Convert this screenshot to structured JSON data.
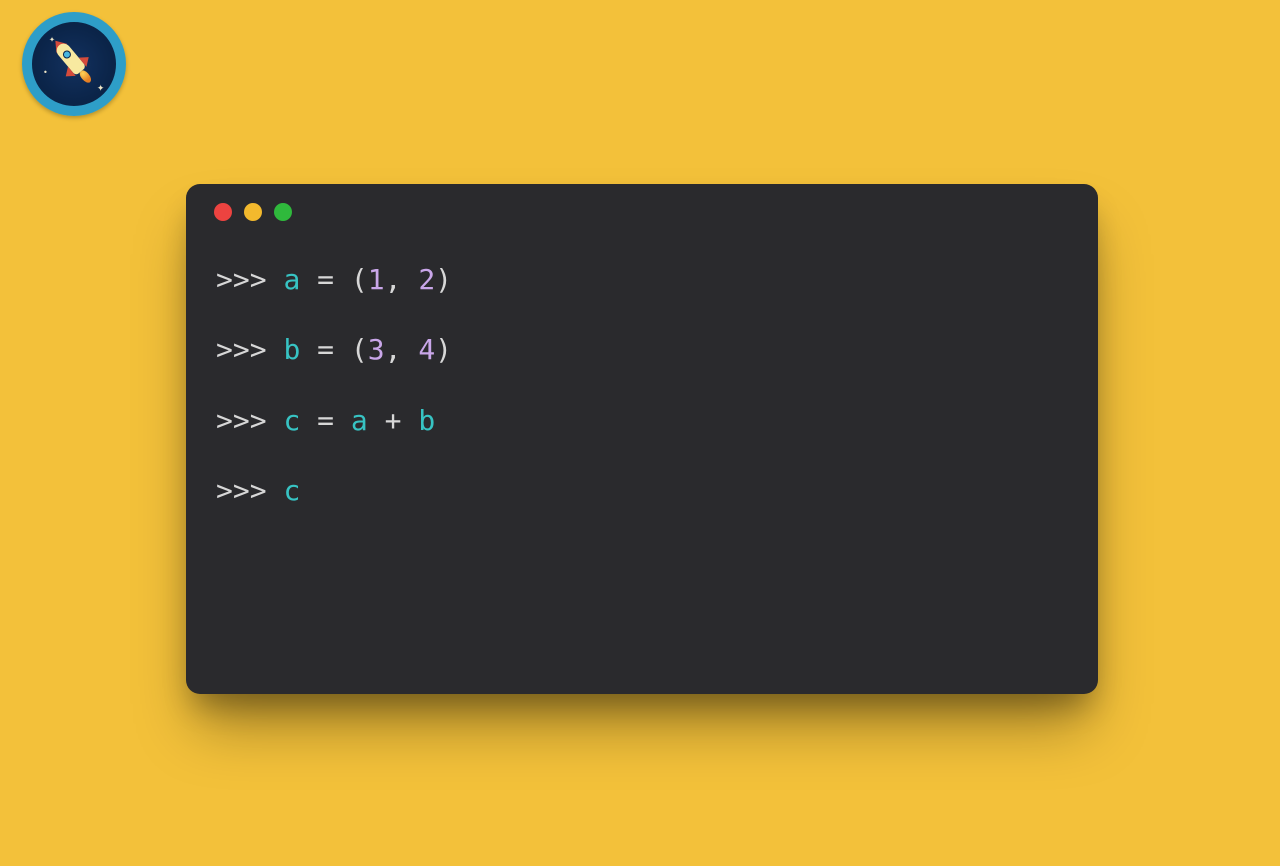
{
  "logo": {
    "name": "python-rocket-logo"
  },
  "window": {
    "traffic_lights": [
      "close",
      "minimize",
      "zoom"
    ]
  },
  "code": {
    "prompt": ">>>",
    "lines": [
      [
        {
          "type": "prompt",
          "text": ">>> "
        },
        {
          "type": "ident",
          "text": "a"
        },
        {
          "type": "op",
          "text": " = "
        },
        {
          "type": "punct",
          "text": "("
        },
        {
          "type": "number",
          "text": "1"
        },
        {
          "type": "punct",
          "text": ", "
        },
        {
          "type": "number",
          "text": "2"
        },
        {
          "type": "punct",
          "text": ")"
        }
      ],
      [
        {
          "type": "prompt",
          "text": ">>> "
        },
        {
          "type": "ident",
          "text": "b"
        },
        {
          "type": "op",
          "text": " = "
        },
        {
          "type": "punct",
          "text": "("
        },
        {
          "type": "number",
          "text": "3"
        },
        {
          "type": "punct",
          "text": ", "
        },
        {
          "type": "number",
          "text": "4"
        },
        {
          "type": "punct",
          "text": ")"
        }
      ],
      [
        {
          "type": "prompt",
          "text": ">>> "
        },
        {
          "type": "ident",
          "text": "c"
        },
        {
          "type": "op",
          "text": " = "
        },
        {
          "type": "ident",
          "text": "a"
        },
        {
          "type": "op",
          "text": " + "
        },
        {
          "type": "ident",
          "text": "b"
        }
      ],
      [
        {
          "type": "prompt",
          "text": ">>> "
        },
        {
          "type": "ident",
          "text": "c"
        }
      ]
    ]
  }
}
